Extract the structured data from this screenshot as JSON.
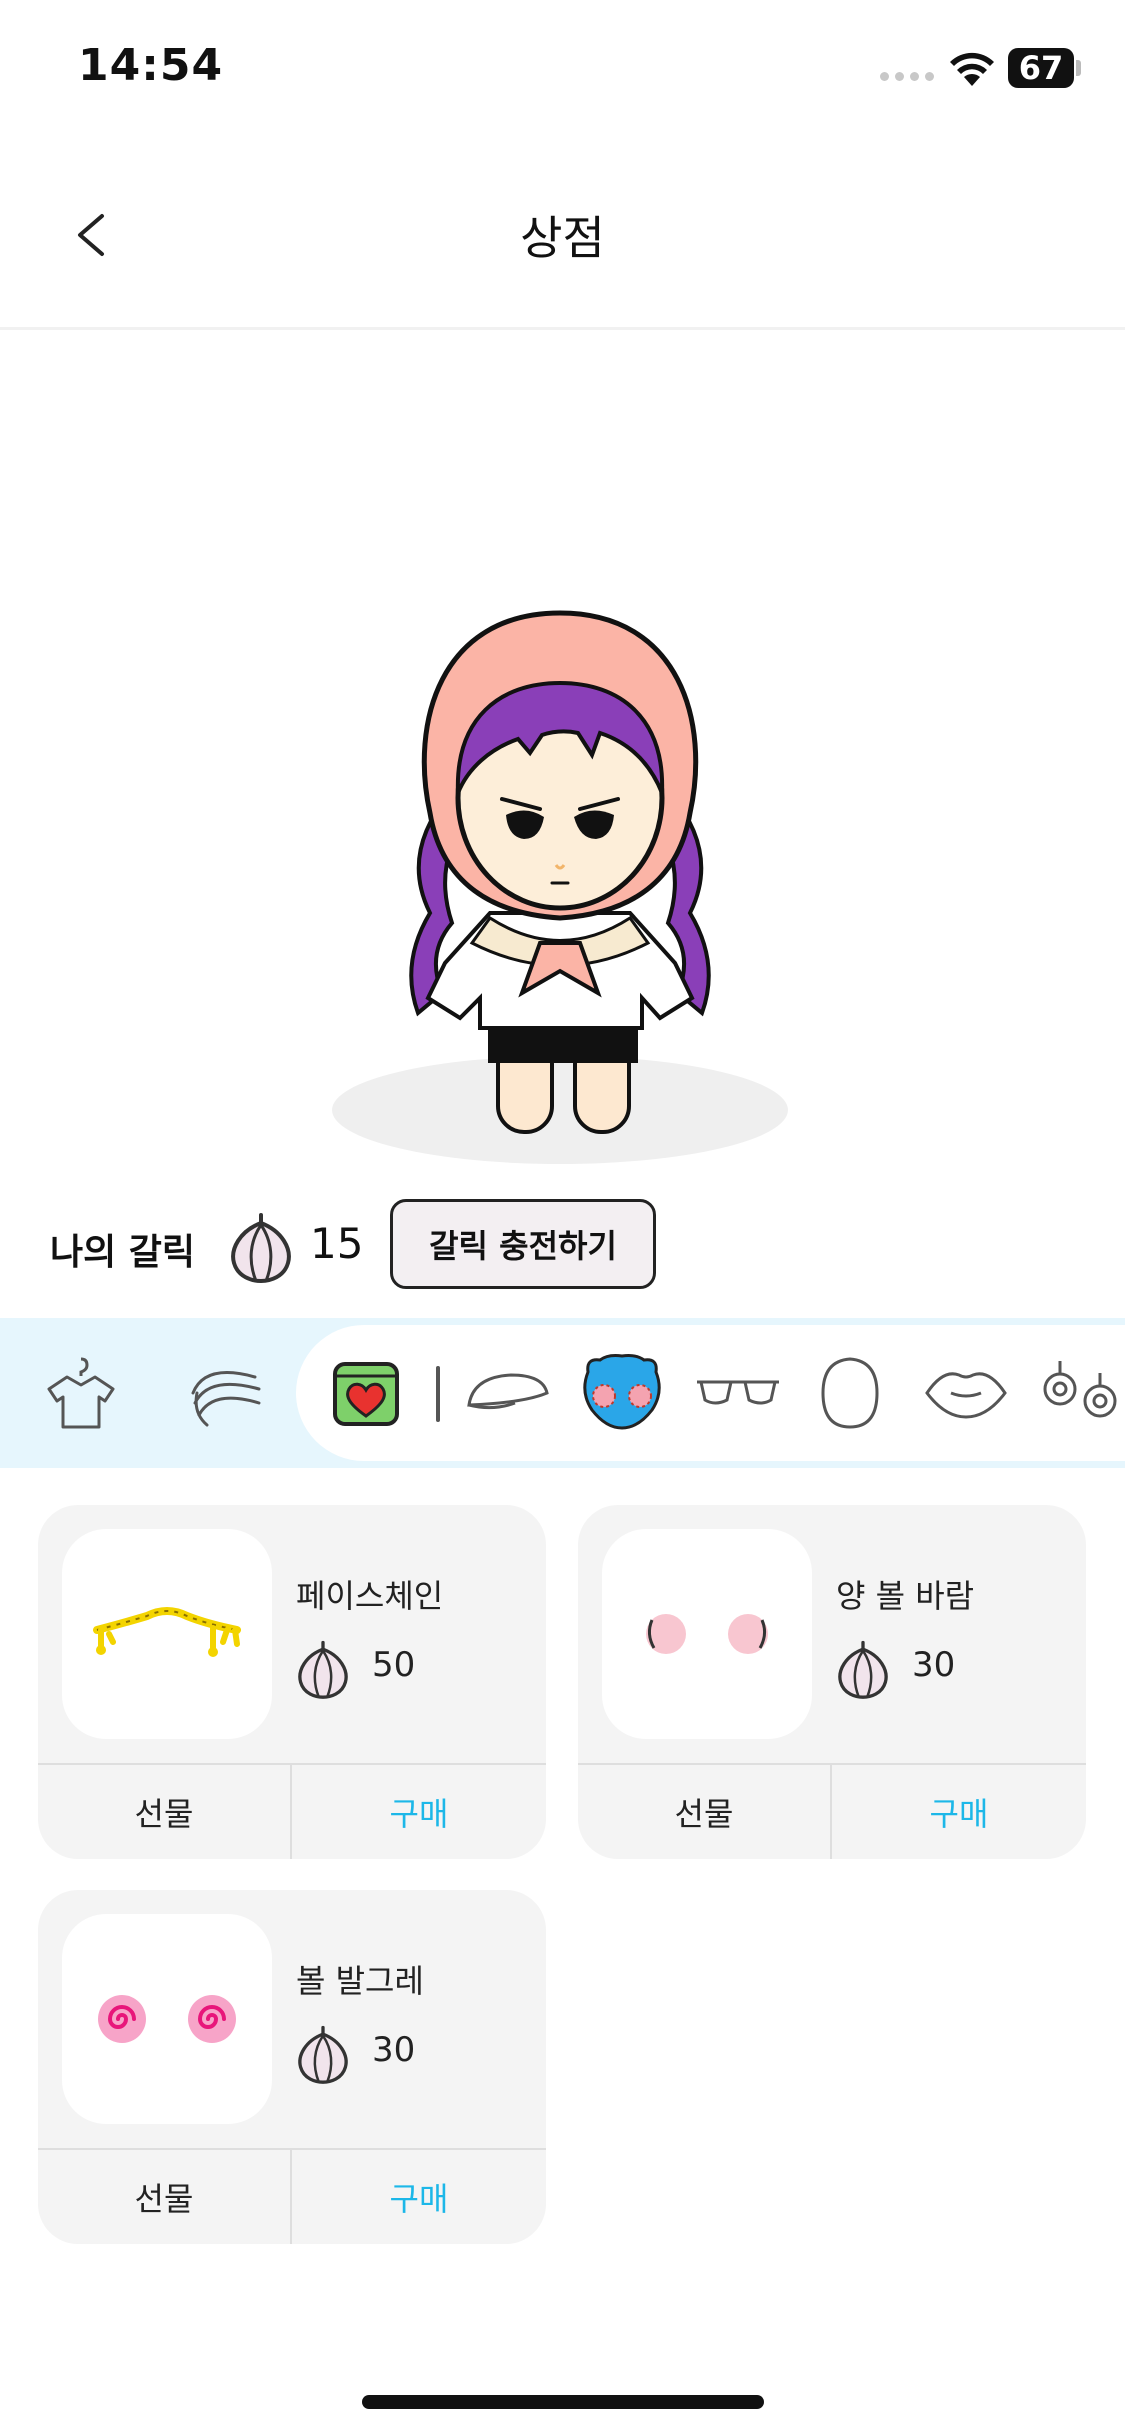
{
  "status_bar": {
    "time": "14:54",
    "battery": "67"
  },
  "nav": {
    "title": "상점"
  },
  "garlic": {
    "label": "나의 갈릭",
    "count": "15",
    "charge_button": "갈릭 충전하기"
  },
  "categories": [
    {
      "name": "clothes",
      "icon": "hanger-shirt-icon"
    },
    {
      "name": "hair",
      "icon": "hair-icon"
    },
    {
      "name": "featured",
      "icon": "heart-box-icon"
    },
    {
      "name": "hat",
      "icon": "cap-icon"
    },
    {
      "name": "cheek",
      "icon": "blush-face-icon",
      "selected": true
    },
    {
      "name": "glasses",
      "icon": "glasses-icon"
    },
    {
      "name": "face",
      "icon": "face-shape-icon"
    },
    {
      "name": "lips",
      "icon": "lips-icon"
    },
    {
      "name": "earrings",
      "icon": "earrings-icon"
    }
  ],
  "products": [
    {
      "name": "페이스체인",
      "price": "50",
      "gift_label": "선물",
      "buy_label": "구매",
      "thumb": "face-chain-icon"
    },
    {
      "name": "양 볼 바람",
      "price": "30",
      "gift_label": "선물",
      "buy_label": "구매",
      "thumb": "puffed-cheeks-icon"
    },
    {
      "name": "볼 발그레",
      "price": "30",
      "gift_label": "선물",
      "buy_label": "구매",
      "thumb": "swirl-blush-icon"
    }
  ],
  "colors": {
    "accent": "#1cb7e8",
    "category_bar": "#e6f6fd",
    "card": "#f4f4f4"
  }
}
